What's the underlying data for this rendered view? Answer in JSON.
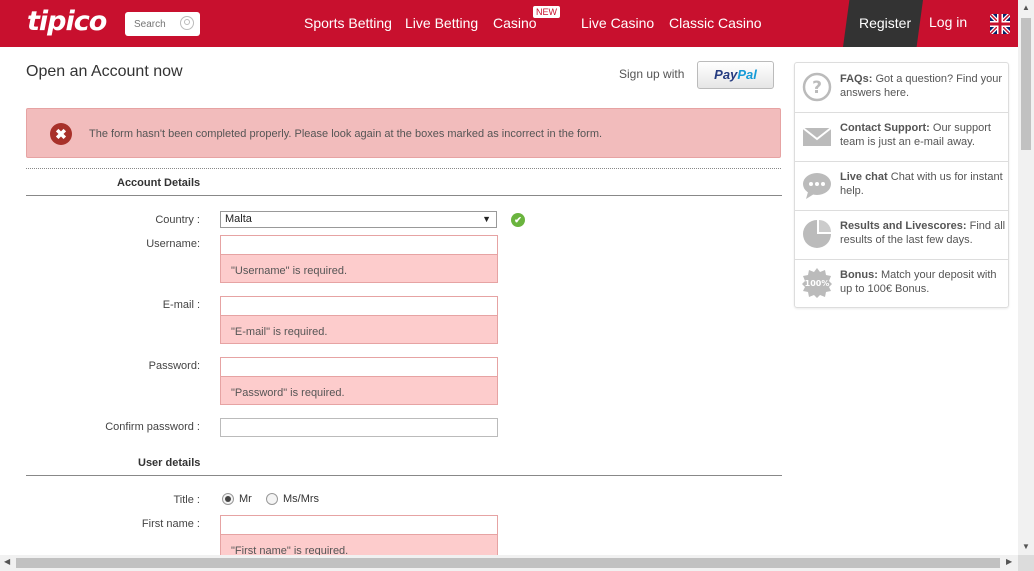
{
  "header": {
    "logo": "tipico",
    "search_placeholder": "Search",
    "nav": [
      "Sports Betting",
      "Live Betting",
      "Casino",
      "Live Casino",
      "Classic Casino"
    ],
    "new_badge": "NEW",
    "register": "Register",
    "login": "Log in"
  },
  "page": {
    "title": "Open an Account now",
    "signup_with": "Sign up with",
    "paypal_a": "Pay",
    "paypal_b": "Pal",
    "error_message": "The form hasn't been completed properly. Please look again at the boxes marked as incorrect in the form.",
    "error_icon": "✖",
    "ok_icon": "✔"
  },
  "form": {
    "account_section": "Account Details",
    "country_label": "Country :",
    "country_value": "Malta",
    "username_label": "Username:",
    "username_error": "\"Username\" is required.",
    "email_label": "E-mail :",
    "email_error": "\"E-mail\" is required.",
    "password_label": "Password:",
    "password_error": "\"Password\" is required.",
    "confirm_label": "Confirm password :",
    "user_section": "User details",
    "title_label": "Title :",
    "title_options": [
      "Mr",
      "Ms/Mrs"
    ],
    "title_selected": "Mr",
    "firstname_label": "First name :",
    "firstname_error": "\"First name\" is required."
  },
  "sidebar": {
    "items": [
      {
        "icon": "question-icon",
        "title": "FAQs:",
        "text": " Got a question? Find your answers here."
      },
      {
        "icon": "envelope-icon",
        "title": "Contact Support:",
        "text": " Our support team is just an e-mail away."
      },
      {
        "icon": "chat-icon",
        "title": "Live chat",
        "text": " Chat with us for instant help."
      },
      {
        "icon": "pie-chart-icon",
        "title": "Results and Livescores:",
        "text": " Find all results of the last few days."
      },
      {
        "icon": "bonus-badge-icon",
        "title": "Bonus:",
        "text": " Match your deposit with up to 100€ Bonus.",
        "badge": "100%"
      }
    ]
  },
  "colors": {
    "brand": "#c8102e",
    "error_bg": "#fdcccc",
    "ok": "#6ab43e"
  }
}
